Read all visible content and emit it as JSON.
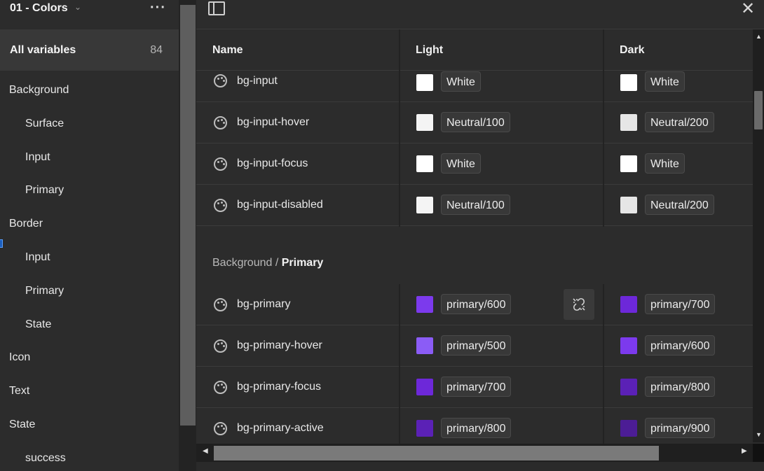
{
  "sidebar": {
    "collection_title": "01 - Colors",
    "all_variables_label": "All variables",
    "all_variables_count": "84",
    "groups": [
      {
        "label": "Background",
        "level": 0
      },
      {
        "label": "Surface",
        "level": 1
      },
      {
        "label": "Input",
        "level": 1
      },
      {
        "label": "Primary",
        "level": 1
      },
      {
        "label": "Border",
        "level": 0
      },
      {
        "label": "Input",
        "level": 1
      },
      {
        "label": "Primary",
        "level": 1
      },
      {
        "label": "State",
        "level": 1
      },
      {
        "label": "Icon",
        "level": 0
      },
      {
        "label": "Text",
        "level": 0
      },
      {
        "label": "State",
        "level": 0
      },
      {
        "label": "success",
        "level": 1
      }
    ]
  },
  "table": {
    "columns": [
      "Name",
      "Light",
      "Dark"
    ],
    "group_header_parent": "Background / ",
    "group_header_current": "Primary",
    "rows": [
      {
        "name": "bg-input",
        "light": "White",
        "light_color": "#ffffff",
        "dark": "White",
        "dark_color": "#ffffff"
      },
      {
        "name": "bg-input-hover",
        "light": "Neutral/100",
        "light_color": "#f4f4f4",
        "dark": "Neutral/200",
        "dark_color": "#e6e6e6"
      },
      {
        "name": "bg-input-focus",
        "light": "White",
        "light_color": "#ffffff",
        "dark": "White",
        "dark_color": "#ffffff"
      },
      {
        "name": "bg-input-disabled",
        "light": "Neutral/100",
        "light_color": "#f4f4f4",
        "dark": "Neutral/200",
        "dark_color": "#e6e6e6"
      },
      {
        "name": "bg-primary",
        "light": "primary/600",
        "light_color": "#7c3aed",
        "dark": "primary/700",
        "dark_color": "#6d28d9"
      },
      {
        "name": "bg-primary-hover",
        "light": "primary/500",
        "light_color": "#8b5cf6",
        "dark": "primary/600",
        "dark_color": "#7c3aed"
      },
      {
        "name": "bg-primary-focus",
        "light": "primary/700",
        "light_color": "#6d28d9",
        "dark": "primary/800",
        "dark_color": "#5b21b6"
      },
      {
        "name": "bg-primary-active",
        "light": "primary/800",
        "light_color": "#5b21b6",
        "dark": "primary/900",
        "dark_color": "#4c1d95"
      }
    ]
  },
  "icons": {
    "more": "more-horizontal-icon",
    "panel": "sidebar-panel-icon",
    "close": "close-icon",
    "variable": "color-palette-icon",
    "detach": "detach-link-icon"
  }
}
